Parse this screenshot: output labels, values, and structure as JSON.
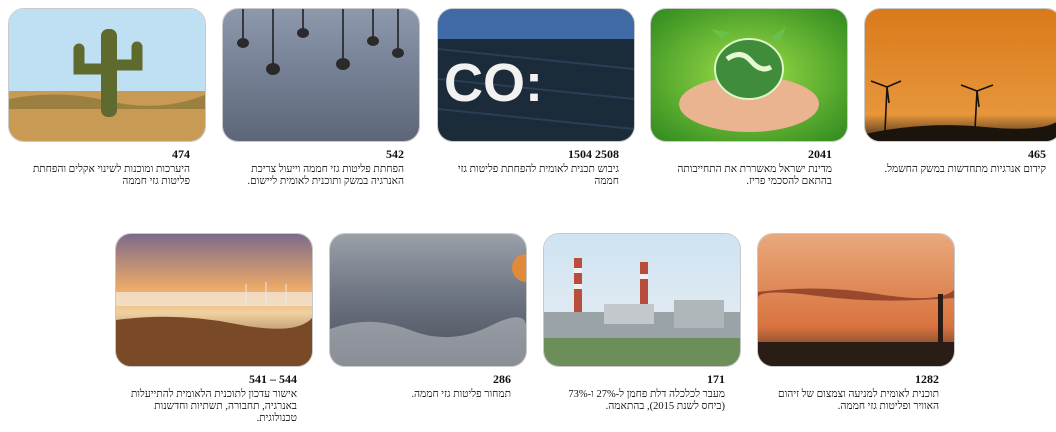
{
  "cards": [
    {
      "number": "465",
      "text": "קידום אנרגיות מתחדשות במשק החשמל.",
      "image": "wind-turbines-sunset"
    },
    {
      "number": "2041",
      "text": "מדינת ישראל מאשררת את התחייבותה בהתאם להסכמי פריז.",
      "image": "hands-globe"
    },
    {
      "number": "2508 1504",
      "text": "גיבוש תכנית לאומית להפחתת פליטות גזי חממה",
      "image": "co2-chalkboard"
    },
    {
      "number": "542",
      "text": "הפחתת פליטות גזי חממה וייעול צריכת האנרגיה במשק ותוכנית לאומית ליישום.",
      "image": "hanging-bulbs"
    },
    {
      "number": "474",
      "text": "היערכות ומוכנות לשינוי אקלים והפחתת פליטות גזי חממה",
      "image": "desert-cactus"
    },
    {
      "number": "1282",
      "text": "תוכנית לאומית למניעה וצמצום של זיהום האוויר ופליטות גזי חממה.",
      "image": "smokestack-sunset"
    },
    {
      "number": "171",
      "text": "מעבר לכלכלה דלת פחמן ל-27% ו-73% (ביחס לשנת 2015), בהתאמה.",
      "image": "power-plant"
    },
    {
      "number": "286",
      "text": "תמחור פליטות גזי חממה.",
      "image": "grey-abstract"
    },
    {
      "number": "544 – 541",
      "text": "אישור עדכון לתוכנית הלאומית להתייעלות באנרגיה, תחבורה, תשתיות וחדשנות טכנולוגית.",
      "image": "misty-landscape"
    }
  ]
}
